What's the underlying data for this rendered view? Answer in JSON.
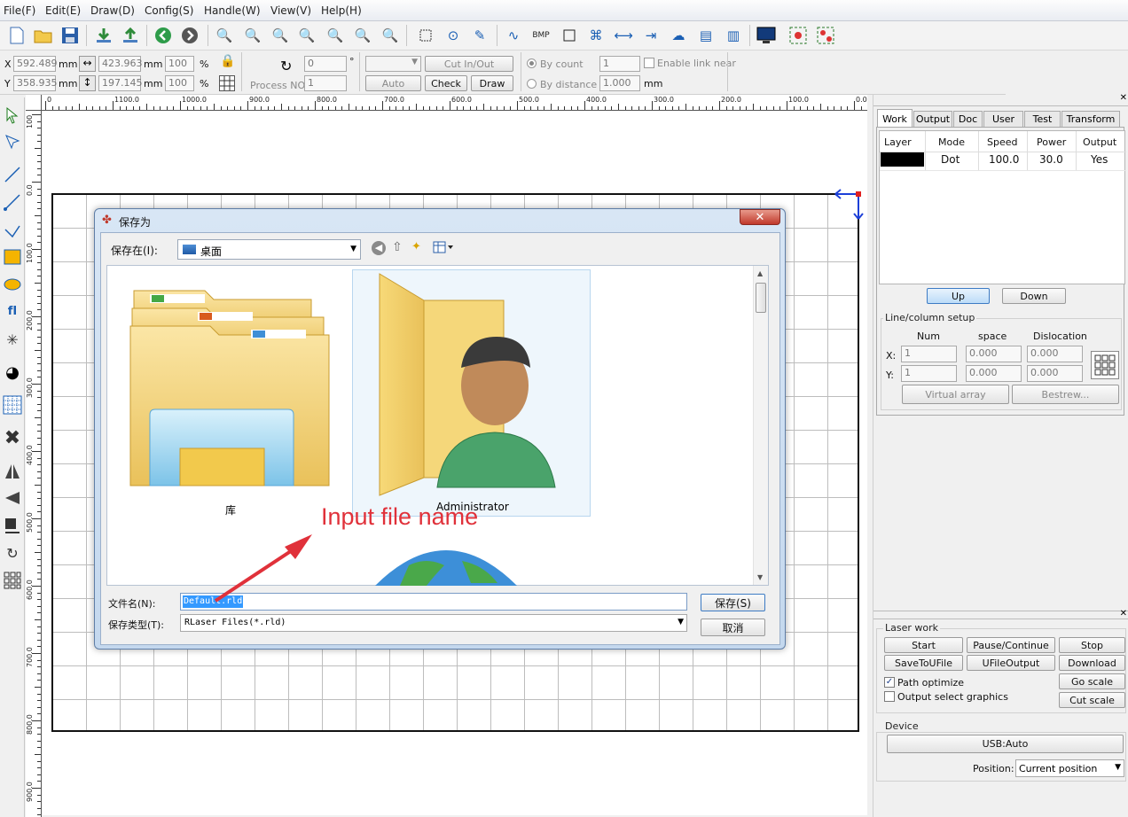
{
  "menu": [
    "File(F)",
    "Edit(E)",
    "Draw(D)",
    "Config(S)",
    "Handle(W)",
    "View(V)",
    "Help(H)"
  ],
  "props": {
    "x_label": "X",
    "y_label": "Y",
    "x_value": "592.489",
    "y_value": "358.935",
    "unit": "mm",
    "width_value": "423.963",
    "height_value": "197.145",
    "scale_x": "100",
    "scale_y": "100",
    "percent": "%",
    "angle_value": "0",
    "degree": "°",
    "process_no_label": "Process NO:",
    "process_no_value": "1",
    "cut_in_out": "Cut In/Out",
    "auto": "Auto",
    "check": "Check",
    "draw": "Draw",
    "by_count": "By count",
    "by_count_value": "1",
    "by_distance": "By distance",
    "by_distance_value": "1.000",
    "enable_link_near": "Enable link near"
  },
  "ruler": {
    "h_ticks": [
      "0",
      "1100.0",
      "1000.0",
      "900.0",
      "800.0",
      "700.0",
      "600.0",
      "500.0",
      "400.0",
      "300.0",
      "200.0",
      "100.0",
      "0.0"
    ],
    "v_ticks": [
      "100",
      "0.0",
      "100.0",
      "200.0",
      "300.0",
      "400.0",
      "500.0",
      "600.0",
      "700.0",
      "800.0",
      "900.0"
    ]
  },
  "work_panel": {
    "tabs": [
      "Work",
      "Output",
      "Doc",
      "User",
      "Test",
      "Transform"
    ],
    "columns": [
      "Layer",
      "Mode",
      "Speed",
      "Power",
      "Output"
    ],
    "row": {
      "color": "#000000",
      "mode": "Dot",
      "speed": "100.0",
      "power": "30.0",
      "output": "Yes"
    },
    "up": "Up",
    "down": "Down",
    "line_column_setup": "Line/column setup",
    "num": "Num",
    "space": "space",
    "dislocation": "Dislocation",
    "x_label": "X:",
    "y_label": "Y:",
    "x_num": "1",
    "x_space": "0.000",
    "x_dislocation": "0.000",
    "y_num": "1",
    "y_space": "0.000",
    "y_dislocation": "0.000",
    "virtual_array": "Virtual array",
    "bestrew": "Bestrew..."
  },
  "laser_panel": {
    "title": "Laser work",
    "start": "Start",
    "pause_continue": "Pause/Continue",
    "stop": "Stop",
    "save_to_ufile": "SaveToUFile",
    "ufile_output": "UFileOutput",
    "download": "Download",
    "path_optimize": "Path optimize",
    "output_select_graphics": "Output select graphics",
    "go_scale": "Go scale",
    "cut_scale": "Cut scale",
    "device_title": "Device",
    "usb_auto": "USB:Auto",
    "position_label": "Position:",
    "position_value": "Current position"
  },
  "dialog": {
    "title": "保存为",
    "save_in_label": "保存在(I):",
    "save_in_value": "桌面",
    "items": [
      "库",
      "Administrator"
    ],
    "filename_label": "文件名(N):",
    "filename_value": "Default.rld",
    "filetype_label": "保存类型(T):",
    "filetype_value": "RLaser Files(*.rld)",
    "save_button": "保存(S)",
    "cancel_button": "取消",
    "close": "✕"
  },
  "annotation": {
    "text": "Input file name",
    "color": "#e0313a"
  },
  "colors": {
    "accent": "#1a5fb4",
    "dialog_frame": "#c4d8ee",
    "selection": "#3399ff"
  }
}
